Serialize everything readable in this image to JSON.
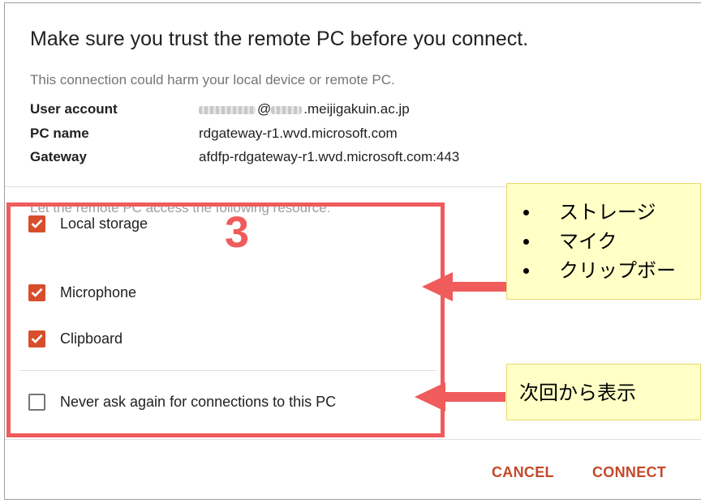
{
  "dialog": {
    "title": "Make sure you trust the remote PC before you connect.",
    "subtitle": "This connection could harm your local device or remote PC.",
    "info": {
      "user_account_label": "User account",
      "user_account_at": "@",
      "user_account_value": ".meijigakuin.ac.jp",
      "pc_name_label": "PC name",
      "pc_name_value": "rdgateway-r1.wvd.microsoft.com",
      "gateway_label": "Gateway",
      "gateway_value": "afdfp-rdgateway-r1.wvd.microsoft.com:443"
    },
    "resources_label": "Let the remote PC access the following resource:",
    "resources": [
      {
        "label": "Local storage",
        "checked": true
      },
      {
        "label": "Microphone",
        "checked": true
      },
      {
        "label": "Clipboard",
        "checked": true
      }
    ],
    "never_ask": {
      "label": "Never ask again for connections to this PC",
      "checked": false
    },
    "buttons": {
      "cancel": "CANCEL",
      "connect": "CONNECT"
    }
  },
  "annotation": {
    "step_number": "3",
    "note_items": [
      "ストレージ",
      "マイク",
      "クリップボー"
    ],
    "note_never_ask": "次回から表示",
    "highlight_color": "#f05b5b",
    "note_background": "#ffffc6"
  },
  "colors": {
    "accent": "#c4492a",
    "checkbox_checked": "#d64e2c"
  }
}
